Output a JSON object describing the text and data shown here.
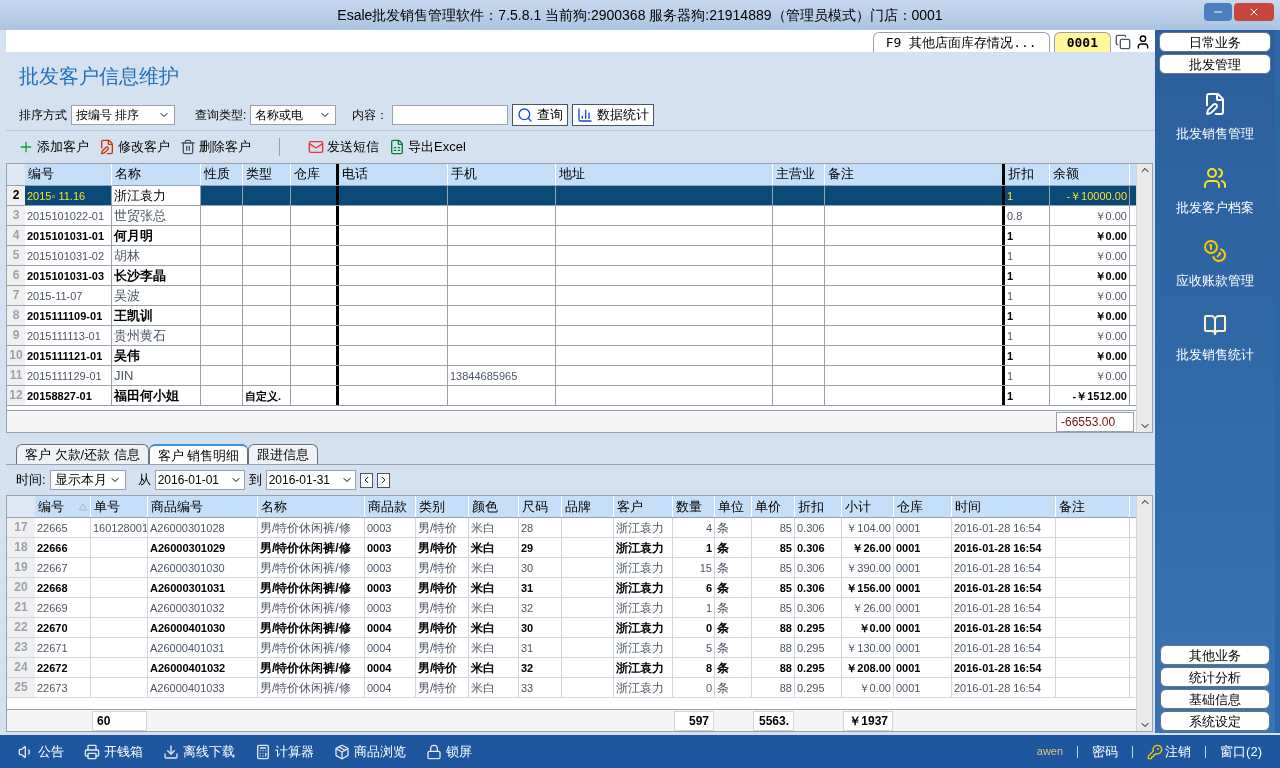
{
  "window": {
    "title": "Esale批发销售管理软件：7.5.8.1 当前狗:2900368  服务器狗:21914889（管理员模式）门店：0001"
  },
  "doc_tabs": [
    {
      "label": "F9 其他店面库存情况...",
      "selected": false
    },
    {
      "label": "0001",
      "selected": true
    }
  ],
  "page_title": "批发客户信息维护",
  "search": {
    "sort_label": "排序方式",
    "sort_value": "按编号  排序",
    "type_label": "查询类型:",
    "type_value": "名称或电",
    "content_label": "内容：",
    "query_button": "查询",
    "stats_button": "数据统计"
  },
  "actions": [
    {
      "label": "添加客户",
      "kind": "add"
    },
    {
      "label": "修改客户",
      "kind": "edit"
    },
    {
      "label": "删除客户",
      "kind": "delete"
    },
    {
      "label": "发送短信",
      "kind": "sms"
    },
    {
      "label": "导出Excel",
      "kind": "excel"
    }
  ],
  "customers": {
    "columns": [
      "编号",
      "名称",
      "性质",
      "类型",
      "仓库",
      "电话",
      "手机",
      "地址",
      "主营业",
      "备注",
      "折扣",
      "余额"
    ],
    "rows": [
      {
        "no": "2",
        "selected": true,
        "cells": [
          "2015◦ 11.16",
          "浙江袁力",
          null,
          null,
          null,
          null,
          null,
          null,
          null,
          null,
          "1",
          "-￥10000.00"
        ]
      },
      {
        "no": "3",
        "selected": false,
        "cells": [
          "2015101022-01",
          "世贸张总",
          null,
          null,
          null,
          null,
          null,
          null,
          null,
          null,
          "0.8",
          "￥0.00"
        ]
      },
      {
        "no": "4",
        "selected": false,
        "cells": [
          "2015101031-01",
          "何月明",
          null,
          null,
          null,
          null,
          null,
          null,
          null,
          null,
          "1",
          "￥0.00"
        ]
      },
      {
        "no": "5",
        "selected": false,
        "cells": [
          "2015101031-02",
          "胡林",
          null,
          null,
          null,
          null,
          null,
          null,
          null,
          null,
          "1",
          "￥0.00"
        ]
      },
      {
        "no": "6",
        "selected": false,
        "cells": [
          "2015101031-03",
          "长沙李晶",
          null,
          null,
          null,
          null,
          null,
          null,
          null,
          null,
          "1",
          "￥0.00"
        ]
      },
      {
        "no": "7",
        "selected": false,
        "cells": [
          "2015-11-07",
          "吴波",
          null,
          null,
          null,
          null,
          null,
          null,
          null,
          null,
          "1",
          "￥0.00"
        ]
      },
      {
        "no": "8",
        "selected": false,
        "cells": [
          "2015111109-01",
          "王凯训",
          null,
          null,
          null,
          null,
          null,
          null,
          null,
          null,
          "1",
          "￥0.00"
        ]
      },
      {
        "no": "9",
        "selected": false,
        "cells": [
          "2015111113-01",
          "贵州黄石",
          null,
          null,
          null,
          null,
          null,
          null,
          null,
          null,
          "1",
          "￥0.00"
        ]
      },
      {
        "no": "10",
        "selected": false,
        "cells": [
          "2015111121-01",
          "吴伟",
          null,
          null,
          null,
          null,
          null,
          null,
          null,
          null,
          "1",
          "￥0.00"
        ]
      },
      {
        "no": "11",
        "selected": false,
        "cells": [
          "2015111129-01",
          "JIN",
          null,
          null,
          null,
          null,
          "13844685965",
          null,
          null,
          null,
          "1",
          "￥0.00"
        ]
      },
      {
        "no": "12",
        "selected": false,
        "cells": [
          "20158827-01",
          "福田何小姐",
          null,
          "自定义.",
          null,
          null,
          null,
          null,
          null,
          null,
          "1",
          "-￥1512.00"
        ]
      }
    ],
    "total": "-66553.00"
  },
  "detail_tabs": [
    {
      "label": "客户 欠款/还款 信息",
      "selected": false
    },
    {
      "label": "客户 销售明细",
      "selected": true
    },
    {
      "label": "跟进信息",
      "selected": false
    }
  ],
  "filter": {
    "time_label": "时间:",
    "period": "显示本月",
    "from_label": "从",
    "from": "2016-01-01",
    "to_label": "到",
    "to": "2016-01-31"
  },
  "sales": {
    "columns": [
      "编号",
      "单号",
      "商品编号",
      "名称",
      "商品款",
      "类别",
      "颜色",
      "尺码",
      "品牌",
      "客户",
      "数量",
      "单位",
      "单价",
      "折扣",
      "小计",
      "仓库",
      "时间",
      "备注"
    ],
    "rows": [
      {
        "no": "17",
        "cells": [
          "22665",
          "160128001",
          "A26000301028",
          "男/特价休闲裤/修",
          "0003",
          "男/特价",
          "米白",
          "28",
          null,
          "浙江袁力",
          "4",
          "条",
          "85",
          "0.306",
          "￥104.00",
          "0001",
          "2016-01-28 16:54",
          null
        ]
      },
      {
        "no": "18",
        "cells": [
          "22666",
          null,
          "A26000301029",
          "男/特价休闲裤/修",
          "0003",
          "男/特价",
          "米白",
          "29",
          null,
          "浙江袁力",
          "1",
          "条",
          "85",
          "0.306",
          "￥26.00",
          "0001",
          "2016-01-28 16:54",
          null
        ]
      },
      {
        "no": "19",
        "cells": [
          "22667",
          null,
          "A26000301030",
          "男/特价休闲裤/修",
          "0003",
          "男/特价",
          "米白",
          "30",
          null,
          "浙江袁力",
          "15",
          "条",
          "85",
          "0.306",
          "￥390.00",
          "0001",
          "2016-01-28 16:54",
          null
        ]
      },
      {
        "no": "20",
        "cells": [
          "22668",
          null,
          "A26000301031",
          "男/特价休闲裤/修",
          "0003",
          "男/特价",
          "米白",
          "31",
          null,
          "浙江袁力",
          "6",
          "条",
          "85",
          "0.306",
          "￥156.00",
          "0001",
          "2016-01-28 16:54",
          null
        ]
      },
      {
        "no": "21",
        "cells": [
          "22669",
          null,
          "A26000301032",
          "男/特价休闲裤/修",
          "0003",
          "男/特价",
          "米白",
          "32",
          null,
          "浙江袁力",
          "1",
          "条",
          "85",
          "0.306",
          "￥26.00",
          "0001",
          "2016-01-28 16:54",
          null
        ]
      },
      {
        "no": "22",
        "cells": [
          "22670",
          null,
          "A26000401030",
          "男/特价休闲裤/修",
          "0004",
          "男/特价",
          "米白",
          "30",
          null,
          "浙江袁力",
          "0",
          "条",
          "88",
          "0.295",
          "￥0.00",
          "0001",
          "2016-01-28 16:54",
          null
        ]
      },
      {
        "no": "23",
        "cells": [
          "22671",
          null,
          "A26000401031",
          "男/特价休闲裤/修",
          "0004",
          "男/特价",
          "米白",
          "31",
          null,
          "浙江袁力",
          "5",
          "条",
          "88",
          "0.295",
          "￥130.00",
          "0001",
          "2016-01-28 16:54",
          null
        ]
      },
      {
        "no": "24",
        "cells": [
          "22672",
          null,
          "A26000401032",
          "男/特价休闲裤/修",
          "0004",
          "男/特价",
          "米白",
          "32",
          null,
          "浙江袁力",
          "8",
          "条",
          "88",
          "0.295",
          "￥208.00",
          "0001",
          "2016-01-28 16:54",
          null
        ]
      },
      {
        "no": "25",
        "cells": [
          "22673",
          null,
          "A26000401033",
          "男/特价休闲裤/修",
          "0004",
          "男/特价",
          "米白",
          "33",
          null,
          "浙江袁力",
          "0",
          "条",
          "88",
          "0.295",
          "￥0.00",
          "0001",
          "2016-01-28 16:54",
          null
        ]
      }
    ],
    "footer": [
      {
        "kind": "order",
        "text": "60"
      },
      {
        "kind": "quantity",
        "text": "597"
      },
      {
        "kind": "price",
        "text": "5563."
      },
      {
        "kind": "subtotal",
        "text": "￥1937"
      }
    ]
  },
  "sidebar": {
    "top_buttons": [
      "日常业务",
      "批发管理"
    ],
    "items": [
      {
        "label": "批发销售管理",
        "kind": "sales"
      },
      {
        "label": "批发客户档案",
        "kind": "customers"
      },
      {
        "label": "应收账款管理",
        "kind": "receivables"
      },
      {
        "label": "批发销售统计",
        "kind": "stats"
      }
    ],
    "bottom_buttons": [
      "其他业务",
      "统计分析",
      "基础信息",
      "系统设定"
    ]
  },
  "taskbar": {
    "items": [
      {
        "label": "公告",
        "kind": "notice"
      },
      {
        "label": "开钱箱",
        "kind": "cashbox"
      },
      {
        "label": "离线下载",
        "kind": "download"
      },
      {
        "label": "计算器",
        "kind": "calculator"
      },
      {
        "label": "商品浏览",
        "kind": "browse"
      },
      {
        "label": "锁屏",
        "kind": "lock"
      }
    ],
    "user": "awen",
    "password": "密码",
    "logout": "注销",
    "windows": "窗口(2)"
  }
}
